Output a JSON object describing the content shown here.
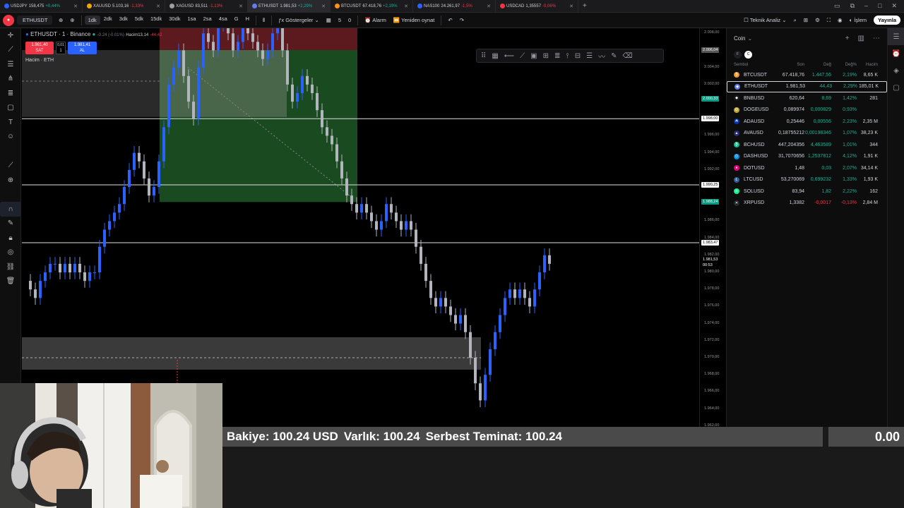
{
  "tabs": [
    {
      "symbol": "USDJPY",
      "price": "158,475",
      "change": "+0,44%",
      "up": true,
      "color": "#2962ff"
    },
    {
      "symbol": "XAUUSD",
      "price": "5.103,16",
      "change": "-1,33%",
      "up": false,
      "color": "#f7a600"
    },
    {
      "symbol": "XAGUSD",
      "price": "83,511",
      "change": "-1,13%",
      "up": false,
      "color": "#9e9e9e"
    },
    {
      "symbol": "ETHUSDT",
      "price": "1.981,53",
      "change": "+2,29%",
      "up": true,
      "color": "#627eea"
    },
    {
      "symbol": "BTCUSDT",
      "price": "67.418,76",
      "change": "+2,19%",
      "up": true,
      "color": "#f7931a"
    },
    {
      "symbol": "NAS100",
      "price": "24.261,97",
      "change": "-1,5%",
      "up": false,
      "color": "#2962ff"
    },
    {
      "symbol": "USDCAD",
      "price": "1,35557",
      "change": "-0,06%",
      "up": false,
      "color": "#f23645"
    }
  ],
  "toolbar": {
    "symbol": "ETHUSDT",
    "intervals": [
      "1dk",
      "2dk",
      "3dk",
      "5dk",
      "15dk",
      "30dk",
      "1sa",
      "2sa",
      "4sa",
      "G",
      "H"
    ],
    "active_interval": "1dk",
    "indicators": "Göstergeler",
    "counter_a": "5",
    "counter_b": "0",
    "alarm": "Alarm",
    "replay": "Yeniden oynat",
    "analysis": "Teknik Analiz",
    "trade": "İşlem",
    "publish": "Yayınla"
  },
  "legend": {
    "title": "ETHUSDT · 1 · Binance",
    "change": "-0.24 (-0.01%)",
    "volume": "Hacim",
    "volume_val": "13,14",
    "volume_ma": "-44,42",
    "sell_price": "1.981,40",
    "sell_label": "SAT",
    "spread": "0,01",
    "qty": "1",
    "buy_price": "1.981,41",
    "buy_label": "AL",
    "volume_label": "Hacim · ETH"
  },
  "price_ticks": [
    "2.008,00",
    "2.006,00",
    "2.004,00",
    "2.002,00",
    "2.000,00",
    "1.998,00",
    "1.996,00",
    "1.994,00",
    "1.992,00",
    "1.990,00",
    "1.988,00",
    "1.986,00",
    "1.984,00",
    "1.982,00",
    "1.980,00",
    "1.978,00",
    "1.976,00",
    "1.974,00",
    "1.972,00",
    "1.970,00",
    "1.968,00",
    "1.966,00",
    "1.964,00",
    "1.962,00"
  ],
  "price_labels": [
    {
      "text": "2.006,04",
      "style": "gray",
      "price": 2006.04
    },
    {
      "text": "2.000,33",
      "style": "green",
      "price": 2000.33
    },
    {
      "text": "1.998,00",
      "style": "white",
      "price": 1998.0
    },
    {
      "text": "1.990,25",
      "style": "white",
      "price": 1990.25
    },
    {
      "text": "1.988,24",
      "style": "green",
      "price": 1988.24
    },
    {
      "text": "1.983,47",
      "style": "white",
      "price": 1983.47
    },
    {
      "text": "1.981,53",
      "style": "dark",
      "price": 1981.53
    },
    {
      "text": "00:53",
      "style": "dark",
      "price": 1980.8
    }
  ],
  "watchlist": {
    "title": "Coin",
    "filter_a": "F",
    "filter_b": "C",
    "columns": [
      "Sembol",
      "Son",
      "Değ",
      "Değ%",
      "Hacim"
    ],
    "rows": [
      {
        "symbol": "BTCUSDT",
        "last": "67.418,76",
        "chg": "1.447,56",
        "pct": "2,19%",
        "vol": "8,65 K",
        "up": true,
        "color": "#f7931a",
        "glyph": "₿"
      },
      {
        "symbol": "ETHUSDT",
        "last": "1.981,53",
        "chg": "44,43",
        "pct": "2,29%",
        "vol": "185,01 K",
        "up": true,
        "color": "#627eea",
        "glyph": "◆"
      },
      {
        "symbol": "BNBUSD",
        "last": "620,64",
        "chg": "8,69",
        "pct": "1,42%",
        "vol": "281",
        "up": true,
        "color": "#1a1a1a",
        "glyph": "◆"
      },
      {
        "symbol": "DOGEUSD",
        "last": "0,089974",
        "chg": "0,000829",
        "pct": "0,93%",
        "vol": "",
        "up": true,
        "color": "#c2a633",
        "glyph": "Ð"
      },
      {
        "symbol": "ADAUSD",
        "last": "0,25446",
        "chg": "0,00556",
        "pct": "2,23%",
        "vol": "2,35 M",
        "up": true,
        "color": "#0033ad",
        "glyph": "₳"
      },
      {
        "symbol": "AVAUSD",
        "last": "0,18755212",
        "chg": "0,00198346",
        "pct": "1,07%",
        "vol": "38,23 K",
        "up": true,
        "color": "#2d2b78",
        "glyph": "▲"
      },
      {
        "symbol": "BCHUSD",
        "last": "447,204356",
        "chg": "4,463589",
        "pct": "1,01%",
        "vol": "344",
        "up": true,
        "color": "#0ac18e",
        "glyph": "₿"
      },
      {
        "symbol": "DASHUSD",
        "last": "31,7070656",
        "chg": "1,2537812",
        "pct": "4,12%",
        "vol": "1,91 K",
        "up": true,
        "color": "#008ce7",
        "glyph": "D"
      },
      {
        "symbol": "DOTUSD",
        "last": "1,48",
        "chg": "0,03",
        "pct": "2,07%",
        "vol": "34,14 K",
        "up": true,
        "color": "#e6007a",
        "glyph": "●"
      },
      {
        "symbol": "LTCUSD",
        "last": "53,270069",
        "chg": "0,699232",
        "pct": "1,33%",
        "vol": "1,93 K",
        "up": true,
        "color": "#345d9d",
        "glyph": "Ł"
      },
      {
        "symbol": "SOLUSD",
        "last": "83,94",
        "chg": "1,82",
        "pct": "2,22%",
        "vol": "162",
        "up": true,
        "color": "#14f195",
        "glyph": "≡"
      },
      {
        "symbol": "XRPUSD",
        "last": "1,3382",
        "chg": "-0,0017",
        "pct": "-0,13%",
        "vol": "2,84 M",
        "up": false,
        "color": "#23292f",
        "glyph": "✕"
      }
    ]
  },
  "account": {
    "balance": "Bakiye: 100.24 USD",
    "equity": "Varlık: 100.24",
    "free_margin": "Serbest Teminat: 100.24",
    "pnl": "0.00"
  },
  "colors": {
    "up": "#2962ff",
    "down": "#b2b5be",
    "green": "#22ab94",
    "red": "#f23645"
  }
}
